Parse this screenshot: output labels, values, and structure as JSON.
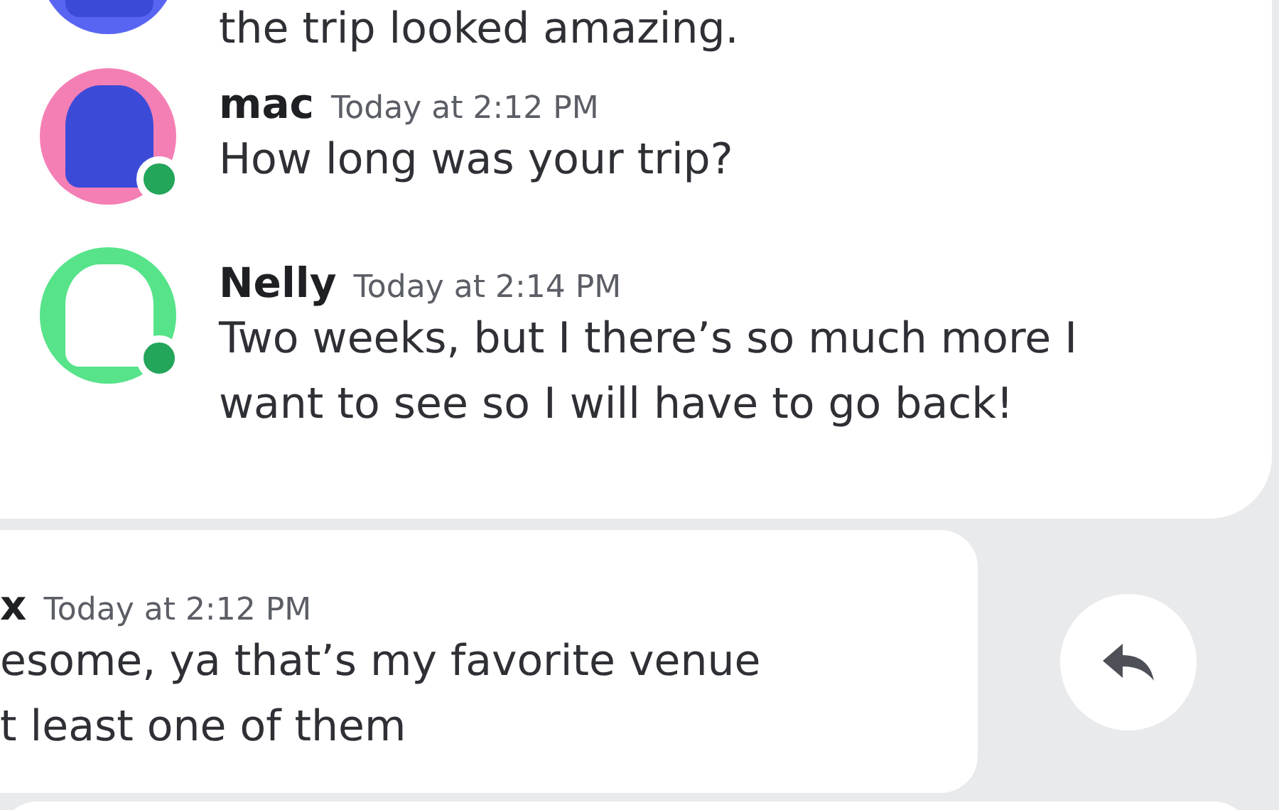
{
  "top_card": {
    "messages": [
      {
        "kind": "continuation",
        "text": [
          "the trip looked amazing."
        ]
      },
      {
        "kind": "full",
        "author": "mac",
        "time": "Today at 2:12 PM",
        "text": [
          "How long was your trip?"
        ],
        "online": true
      },
      {
        "kind": "full",
        "author": "Nelly",
        "time": "Today at 2:14 PM",
        "text": [
          "Two weeks, but I there’s so much more I",
          "want to see so I will have to go back!"
        ],
        "online": true
      }
    ]
  },
  "reply_card": {
    "author": "x",
    "time": "Today at 2:12 PM",
    "text": [
      "esome, ya that’s my favorite venue",
      "t least one of them"
    ]
  }
}
